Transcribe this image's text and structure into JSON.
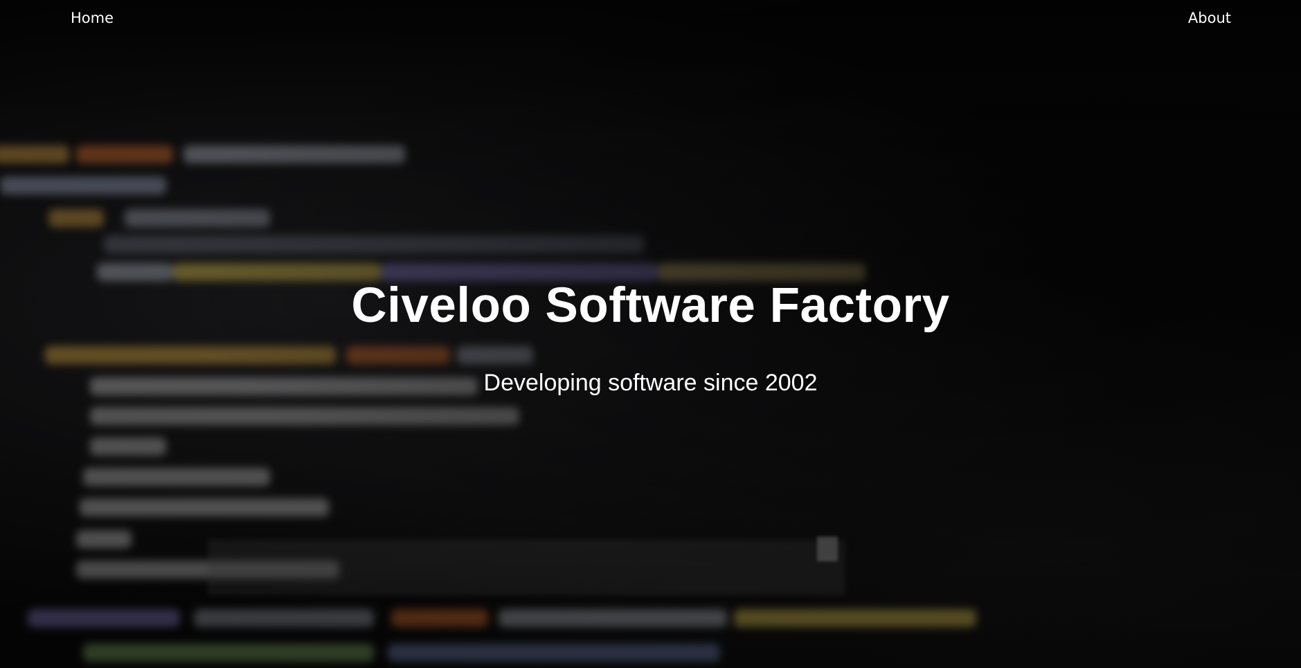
{
  "nav": {
    "home_label": "Home",
    "about_label": "About"
  },
  "hero": {
    "title": "Civeloo Software Factory",
    "subtitle": "Developing software since 2002",
    "background": "blurred-code-editor-image"
  },
  "colors": {
    "background": "#070707",
    "text": "#ffffff"
  }
}
